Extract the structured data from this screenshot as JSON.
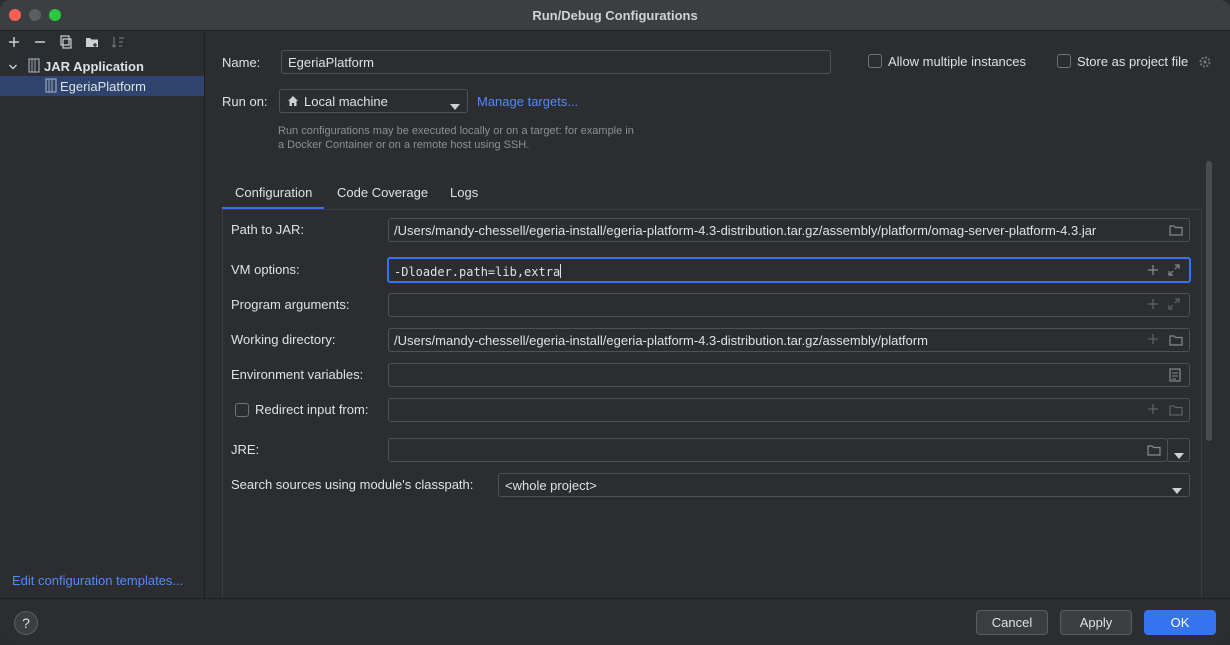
{
  "window": {
    "title": "Run/Debug Configurations"
  },
  "sidebar": {
    "toolbar": [
      "add-icon",
      "remove-icon",
      "copy-icon",
      "folder-icon",
      "sort-icon"
    ],
    "tree": {
      "parent_label": "JAR Application",
      "child_label": "EgeriaPlatform"
    },
    "edit_templates_link": "Edit configuration templates..."
  },
  "header": {
    "name_label": "Name:",
    "name_value": "EgeriaPlatform",
    "allow_multiple_label": "Allow multiple instances",
    "store_project_label": "Store as project file",
    "run_on_label": "Run on:",
    "run_on_value": "Local machine",
    "manage_targets_link": "Manage targets...",
    "hint_text": "Run configurations may be executed locally or on a target: for example in a Docker Container or on a remote host using SSH."
  },
  "tabs": [
    "Configuration",
    "Code Coverage",
    "Logs"
  ],
  "config": {
    "path_to_jar_label": "Path to JAR:",
    "path_to_jar_value": "/Users/mandy-chessell/egeria-install/egeria-platform-4.3-distribution.tar.gz/assembly/platform/omag-server-platform-4.3.jar",
    "vm_options_label": "VM options:",
    "vm_options_value": "-Dloader.path=lib,extra",
    "program_args_label": "Program arguments:",
    "program_args_value": "",
    "working_dir_label": "Working directory:",
    "working_dir_value": "/Users/mandy-chessell/egeria-install/egeria-platform-4.3-distribution.tar.gz/assembly/platform",
    "env_vars_label": "Environment variables:",
    "env_vars_value": "",
    "redirect_input_label": "Redirect input from:",
    "redirect_input_value": "",
    "jre_label": "JRE:",
    "jre_value": "",
    "search_sources_label": "Search sources using module's classpath:",
    "search_sources_value": "<whole project>"
  },
  "footer": {
    "help_label": "?",
    "cancel_label": "Cancel",
    "apply_label": "Apply",
    "ok_label": "OK"
  },
  "colors": {
    "accent": "#3574f0",
    "link": "#548af7",
    "background": "#2b2d30",
    "selected_row": "#2e436e"
  }
}
